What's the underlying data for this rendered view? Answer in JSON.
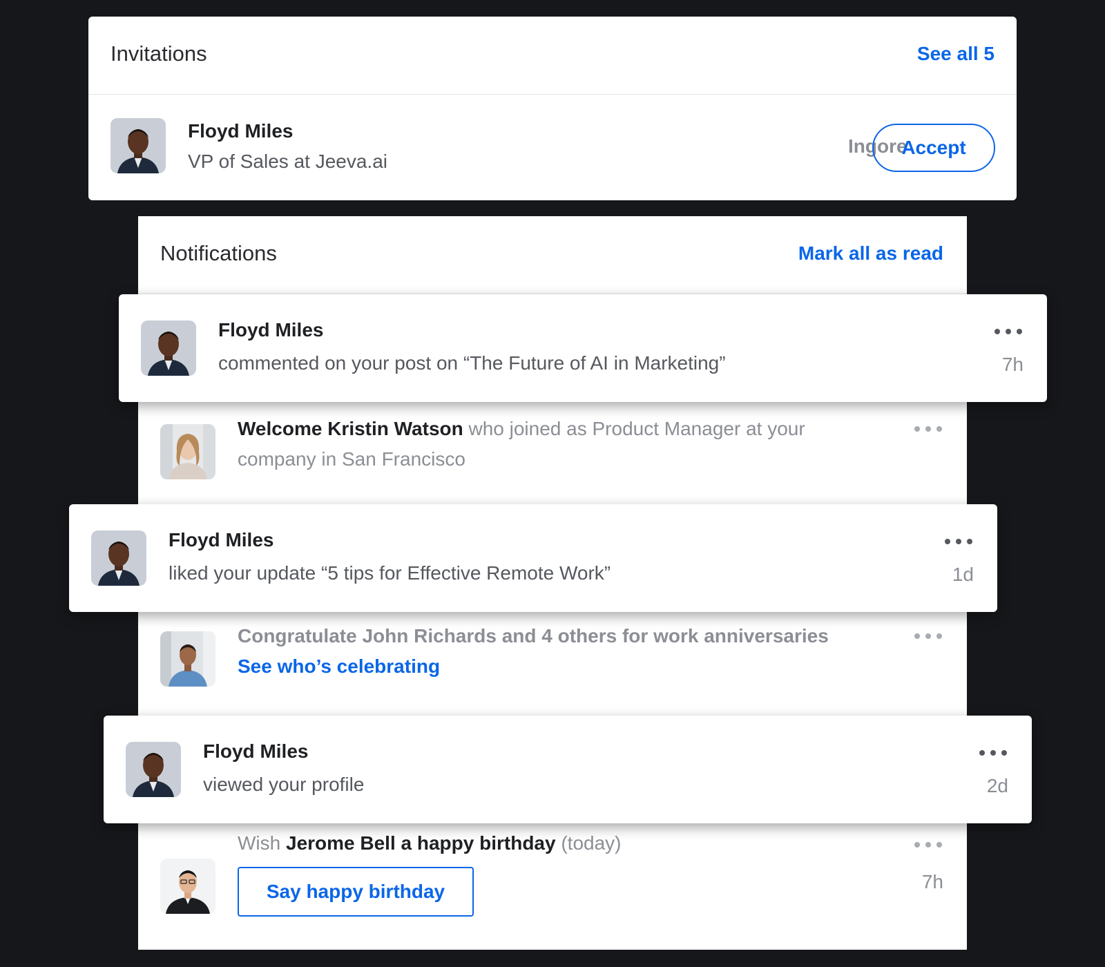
{
  "invitations": {
    "title": "Invitations",
    "see_all_label": "See all 5",
    "item": {
      "name": "Floyd Miles",
      "subtitle": "VP of Sales at Jeeva.ai",
      "ignore_label": "Ingore",
      "accept_label": "Accept"
    }
  },
  "notifications": {
    "title": "Notifications",
    "mark_all_label": "Mark all as read",
    "items": [
      {
        "name": "Floyd Miles",
        "text": "commented on your post on “The Future of AI in Marketing”",
        "time": "7h"
      },
      {
        "name_bold": "Welcome Kristin Watson",
        "text": " who joined as Product Manager at your company in San Francisco"
      },
      {
        "name": "Floyd Miles",
        "text": "liked your update “5 tips for Effective Remote Work”",
        "time": "1d"
      },
      {
        "text": "Congratulate John Richards and 4 others for work anniversaries",
        "link": "See who’s celebrating"
      },
      {
        "name": "Floyd Miles",
        "text": "viewed your profile",
        "time": "2d"
      },
      {
        "prefix": "Wish ",
        "bold": "Jerome Bell a happy birthday",
        "suffix": " (today)",
        "button": "Say happy birthday",
        "time": "7h"
      }
    ]
  },
  "colors": {
    "accent": "#0a66e8",
    "background": "#16171a",
    "card": "#ffffff"
  },
  "icons": [
    "more-dots-icon",
    "avatar-floyd-miles",
    "avatar-kristin-watson",
    "avatar-john-richards",
    "avatar-jerome-bell"
  ]
}
